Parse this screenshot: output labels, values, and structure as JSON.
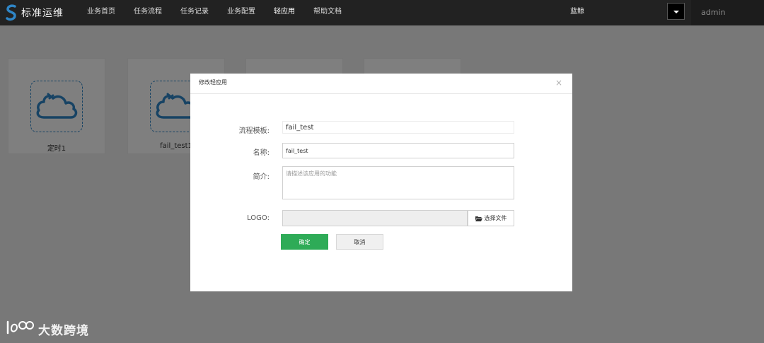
{
  "app": {
    "logo_text": "标准运维"
  },
  "nav": {
    "items": [
      {
        "label": "业务首页"
      },
      {
        "label": "任务流程"
      },
      {
        "label": "任务记录"
      },
      {
        "label": "业务配置"
      },
      {
        "label": "轻应用",
        "active": true
      },
      {
        "label": "帮助文档"
      }
    ]
  },
  "header": {
    "cluster_name": "蓝鲸",
    "username": "admin"
  },
  "cards": [
    {
      "label": "定时1",
      "icon": "cloud-clock-icon"
    },
    {
      "label": "fail_test1",
      "icon": "cloud-clock-icon"
    }
  ],
  "modal": {
    "title": "修改轻应用",
    "close_glyph": "×",
    "template_label": "流程模板:",
    "template_value": "fail_test",
    "name_label": "名称:",
    "name_value": "fail_test",
    "desc_label": "简介:",
    "desc_placeholder": "请描述该应用的功能",
    "logo_label": "LOGO:",
    "choose_file_label": "选择文件",
    "confirm_label": "确定",
    "cancel_label": "取消"
  },
  "watermark": {
    "text": "大数跨境"
  },
  "colors": {
    "accent_green": "#2eab57",
    "icon_blue": "#2f86c8",
    "topbar": "#222222"
  }
}
